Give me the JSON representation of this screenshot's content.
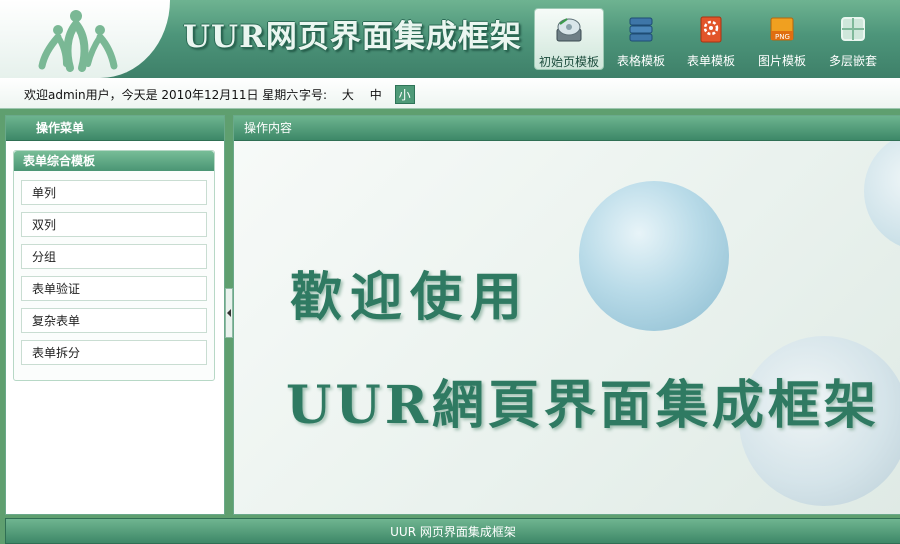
{
  "header": {
    "title": "UUR网页界面集成框架",
    "logo_icon": "people-logo-icon",
    "nav": [
      {
        "label": "初始页模板",
        "icon": "disc-drive-icon",
        "active": true
      },
      {
        "label": "表格模板",
        "icon": "database-stack-icon",
        "active": false
      },
      {
        "label": "表单模板",
        "icon": "gear-form-icon",
        "active": false
      },
      {
        "label": "图片模板",
        "icon": "png-image-icon",
        "active": false
      },
      {
        "label": "多层嵌套",
        "icon": "grid-layout-icon",
        "active": false
      }
    ]
  },
  "infobar": {
    "welcome": "欢迎admin用户，今天是 2010年12月11日 星期六",
    "fontsize_label": "字号:",
    "sizes": [
      "大",
      "中",
      "小"
    ],
    "selected_size": "小"
  },
  "left_panel": {
    "title": "操作菜单",
    "group_title": "表单综合模板",
    "items": [
      "单列",
      "双列",
      "分组",
      "表单验证",
      "复杂表单",
      "表单拆分"
    ]
  },
  "right_panel": {
    "title": "操作内容",
    "welcome_line1": "歡迎使用",
    "welcome_line2": "UUR網頁界面集成框架"
  },
  "footer": {
    "text": "UUR 网页界面集成框架"
  },
  "colors": {
    "brand_green": "#3e8868",
    "header_light": "#6eb391",
    "welcome_text": "#2f7a62"
  }
}
